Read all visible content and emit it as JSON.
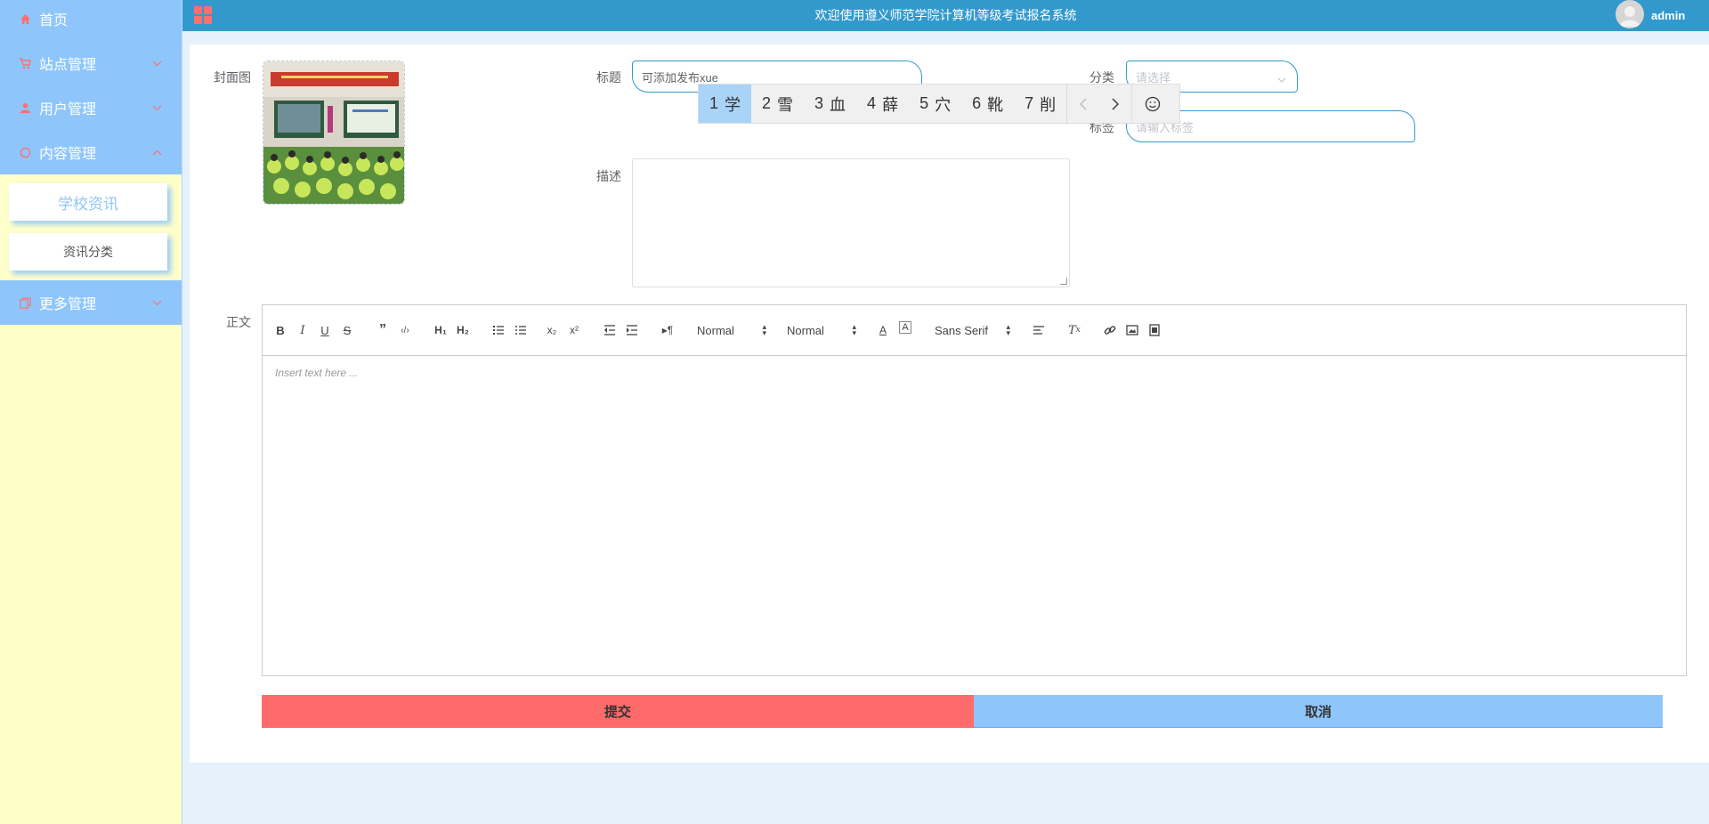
{
  "app": {
    "title": "欢迎使用遵义师范学院计算机等级考试报名系统",
    "user": "admin"
  },
  "sidebar": {
    "items": [
      {
        "label": "首页",
        "icon": "home-icon"
      },
      {
        "label": "站点管理",
        "icon": "cart-icon"
      },
      {
        "label": "用户管理",
        "icon": "user-icon"
      },
      {
        "label": "内容管理",
        "icon": "chat-icon"
      },
      {
        "label": "更多管理",
        "icon": "copy-icon"
      }
    ],
    "sub_items": [
      {
        "label": "学校资讯",
        "active": true
      },
      {
        "label": "资讯分类",
        "active": false
      }
    ],
    "colors": {
      "menu": "#8ec6fb",
      "background": "#ffffc9",
      "icon": "#ff6f6f"
    }
  },
  "form": {
    "cover_label": "封面图",
    "title_label": "标题",
    "title_value": "可添加发布xue",
    "category_label": "分类",
    "category_placeholder": "请选择",
    "tags_label": "标签",
    "tags_placeholder": "请输入标签",
    "desc_label": "描述",
    "body_label": "正文"
  },
  "editor": {
    "header_picker": "Normal",
    "size_picker": "Normal",
    "font_picker": "Sans Serif",
    "placeholder": "Insert text here ..."
  },
  "buttons": {
    "submit": "提交",
    "cancel": "取消"
  },
  "ime": {
    "candidates": [
      {
        "num": "1",
        "char": "学"
      },
      {
        "num": "2",
        "char": "雪"
      },
      {
        "num": "3",
        "char": "血"
      },
      {
        "num": "4",
        "char": "薛"
      },
      {
        "num": "5",
        "char": "穴"
      },
      {
        "num": "6",
        "char": "靴"
      },
      {
        "num": "7",
        "char": "削"
      }
    ]
  },
  "colors": {
    "topbar": "#3399cc",
    "submit": "#ff6b6b",
    "cancel": "#8ec6fb",
    "input_border": "#3399cc"
  }
}
